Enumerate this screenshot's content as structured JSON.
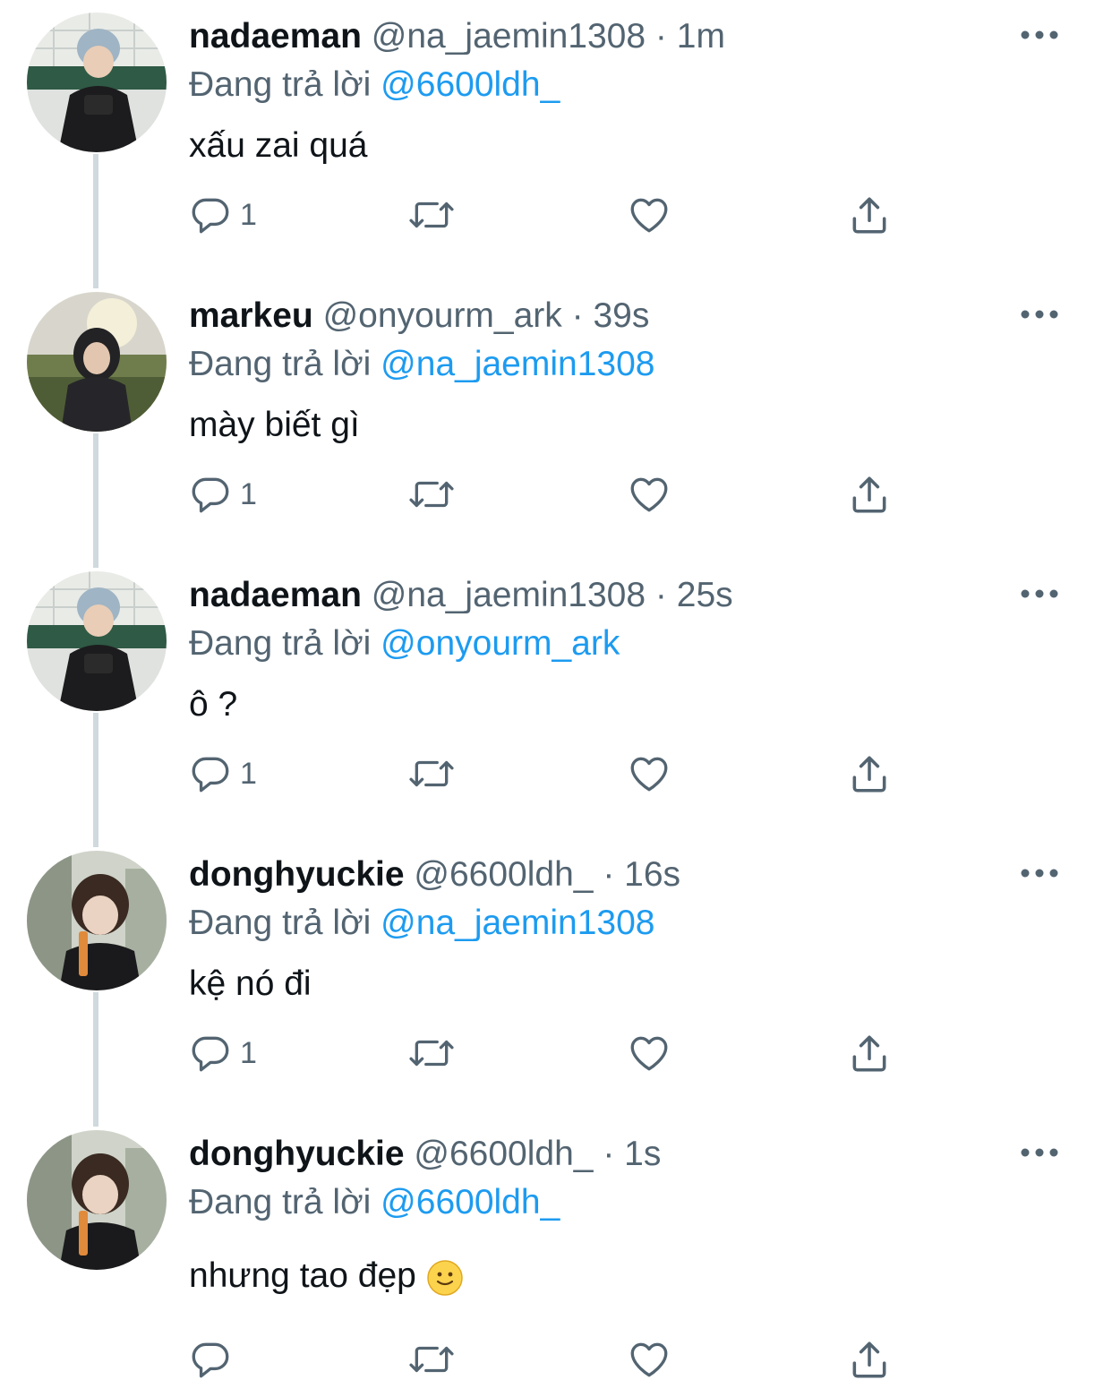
{
  "reply_prefix": "Đang trả lời",
  "tweets": [
    {
      "name": "nadaeman",
      "handle": "@na_jaemin1308",
      "dot": "·",
      "time": "1m",
      "reply_to": "@6600ldh_",
      "text": "xấu zai quá",
      "reply_count": "1"
    },
    {
      "name": "markeu",
      "handle": "@onyourm_ark",
      "dot": "·",
      "time": "39s",
      "reply_to": "@na_jaemin1308",
      "text": "mày biết gì",
      "reply_count": "1"
    },
    {
      "name": "nadaeman",
      "handle": "@na_jaemin1308",
      "dot": "·",
      "time": "25s",
      "reply_to": "@onyourm_ark",
      "text": "ô ?",
      "reply_count": "1"
    },
    {
      "name": "donghyuckie",
      "handle": "@6600ldh_",
      "dot": "·",
      "time": "16s",
      "reply_to": "@na_jaemin1308",
      "text": "kệ nó đi",
      "reply_count": "1"
    },
    {
      "name": "donghyuckie",
      "handle": "@6600ldh_",
      "dot": "·",
      "time": "1s",
      "reply_to": "@6600ldh_",
      "text": "nhưng tao đẹp",
      "reply_count": ""
    }
  ],
  "icons": {
    "reply": "reply-icon",
    "retweet": "retweet-icon",
    "like": "like-icon",
    "share": "share-icon",
    "more": "more-icon",
    "emoji": "slightly-smiling-face-emoji"
  },
  "colors": {
    "link": "#1d9bf0",
    "muted": "#536471",
    "text": "#0f1419",
    "thread": "#cfd9de"
  }
}
